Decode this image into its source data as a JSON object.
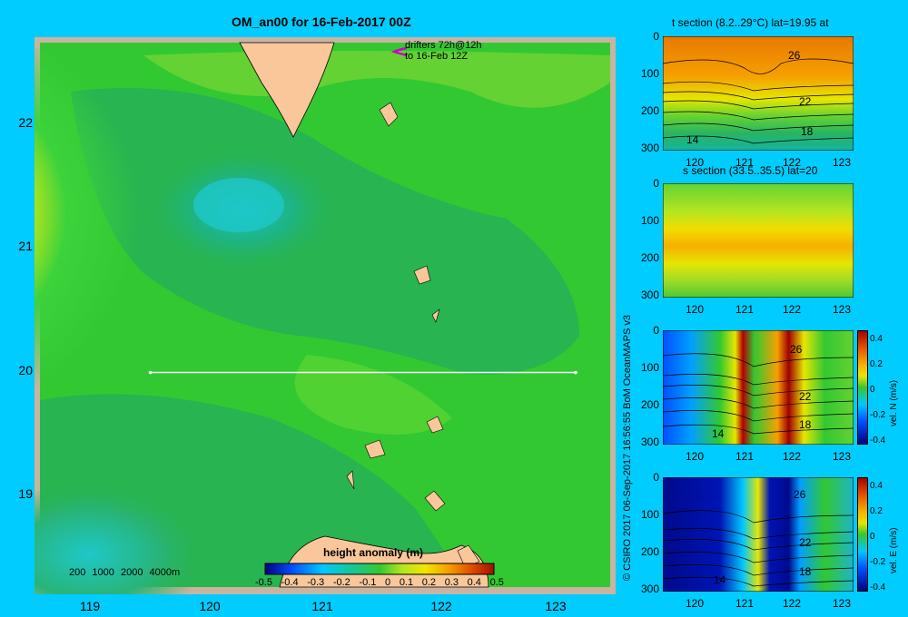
{
  "title": "OM_an00 for 16-Feb-2017 00Z",
  "map": {
    "y_ticks": [
      "22",
      "21",
      "20",
      "19"
    ],
    "x_ticks": [
      "119",
      "120",
      "121",
      "122",
      "123"
    ],
    "drifters": {
      "line1": "drifters 72h@12h",
      "line2": "to 16-Feb 12Z"
    },
    "depth_legend": [
      "200",
      "1000",
      "2000",
      "4000m"
    ],
    "colorbar": {
      "title": "height anomaly (m)",
      "ticks": [
        "-0.5",
        "-0.4",
        "-0.3",
        "-0.2",
        "-0.1",
        "0",
        "0.1",
        "0.2",
        "0.3",
        "0.4",
        "0.5"
      ]
    },
    "section_line": {
      "lat": 20,
      "lon_start": 119.5,
      "lon_end": 123.2
    }
  },
  "panels": [
    {
      "title": "t section (8.2..29°C) lat=19.95 at",
      "y_ticks": [
        "0",
        "100",
        "200",
        "300"
      ],
      "x_ticks": [
        "120",
        "121",
        "122",
        "123"
      ],
      "contour_labels": [
        "26",
        "22",
        "18",
        "14"
      ]
    },
    {
      "title": "s section (33.5..35.5) lat=20",
      "y_ticks": [
        "0",
        "100",
        "200",
        "300"
      ],
      "x_ticks": [
        "120",
        "121",
        "122",
        "123"
      ]
    },
    {
      "title": "",
      "y_ticks": [
        "0",
        "100",
        "200",
        "300"
      ],
      "x_ticks": [
        "120",
        "121",
        "122",
        "123"
      ],
      "contour_labels": [
        "26",
        "22",
        "18",
        "14"
      ],
      "colorbar_ticks": [
        "0.4",
        "0.2",
        "0",
        "-0.2",
        "-0.4"
      ],
      "colorbar_label": "vel. N (m/s)"
    },
    {
      "title": "",
      "y_ticks": [
        "0",
        "100",
        "200",
        "300"
      ],
      "x_ticks": [
        "120",
        "121",
        "122",
        "123"
      ],
      "contour_labels": [
        "26",
        "22",
        "18",
        "14"
      ],
      "colorbar_ticks": [
        "0.4",
        "0.2",
        "0",
        "-0.2",
        "-0.4"
      ],
      "colorbar_label": "vel. E (m/s)"
    }
  ],
  "credit": "© CSIRO 2017   06-Sep-2017 16:56:55 BoM OceanMAPS v3",
  "colors": {
    "background": "#00ccff",
    "land": "#f9c79a",
    "frame": "#c8b4a0"
  }
}
